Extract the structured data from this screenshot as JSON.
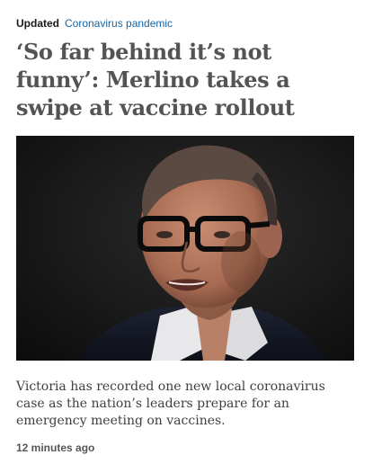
{
  "article": {
    "status_label": "Updated",
    "topic_label": "Coronavirus pandemic",
    "headline": "‘So far behind it’s not funny’: Merlino takes a swipe at vaccine rollout",
    "image": {
      "icon": "news-photo-man-glasses"
    },
    "summary": "Victoria has recorded one new local coronavirus case as the nation’s leaders prepare for an emergency meeting on vaccines.",
    "timestamp": "12 minutes ago"
  },
  "colors": {
    "topic_link": "#1565a8",
    "headline": "#545454",
    "body_text": "#3f3f3f",
    "status": "#1a1a1a"
  }
}
